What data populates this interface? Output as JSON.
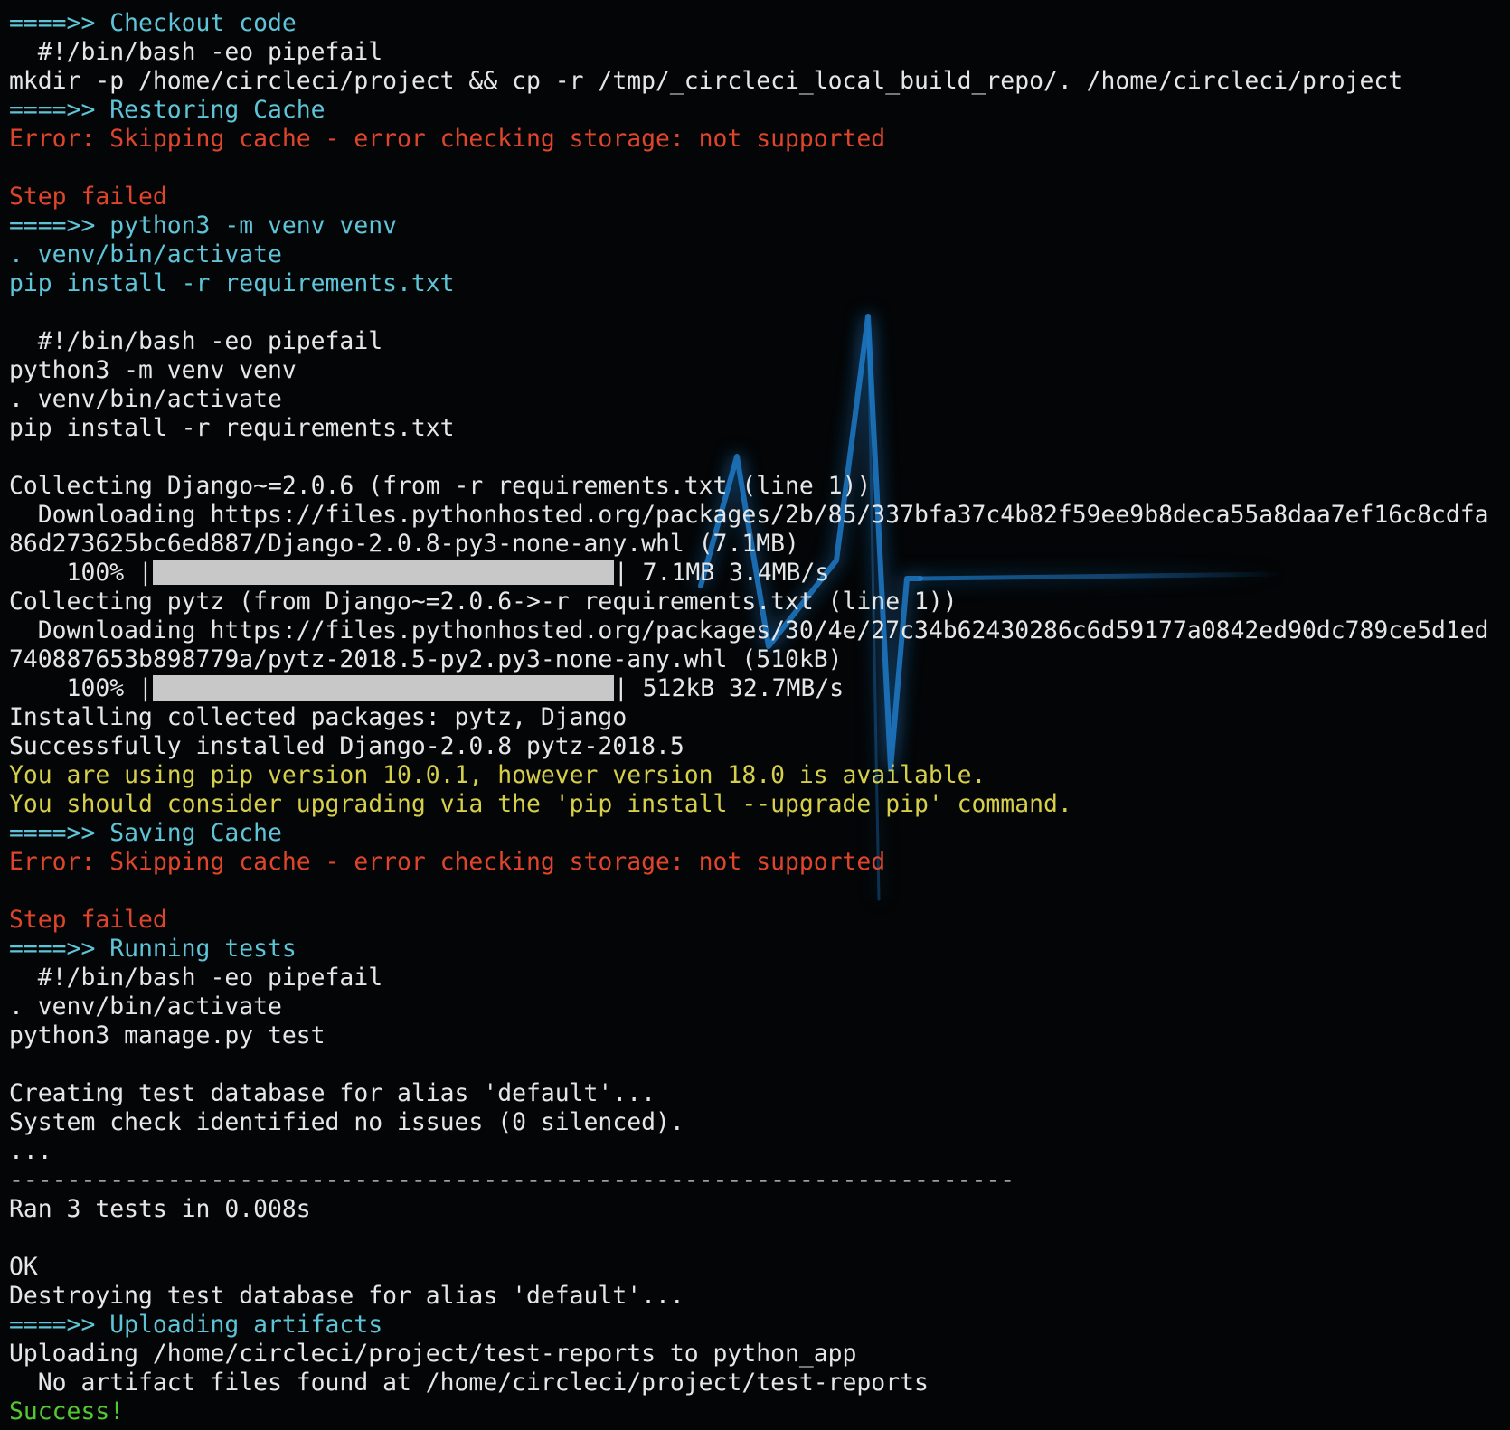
{
  "terminal": {
    "lines": [
      {
        "text": "====>> Checkout code",
        "color": "#5ec4d8"
      },
      {
        "text": "  #!/bin/bash -eo pipefail",
        "color": "#e6e6e6"
      },
      {
        "text": "mkdir -p /home/circleci/project && cp -r /tmp/_circleci_local_build_repo/. /home/circleci/project",
        "color": "#e6e6e6"
      },
      {
        "text": "====>> Restoring Cache",
        "color": "#5ec4d8"
      },
      {
        "text": "Error: Skipping cache - error checking storage: not supported",
        "color": "#e0452c"
      },
      {
        "text": "",
        "color": "#e6e6e6"
      },
      {
        "text": "Step failed",
        "color": "#e0452c"
      },
      {
        "text": "====>> python3 -m venv venv",
        "color": "#5ec4d8"
      },
      {
        "text": ". venv/bin/activate",
        "color": "#5ec4d8"
      },
      {
        "text": "pip install -r requirements.txt",
        "color": "#5ec4d8"
      },
      {
        "text": "",
        "color": "#e6e6e6"
      },
      {
        "text": "  #!/bin/bash -eo pipefail",
        "color": "#e6e6e6"
      },
      {
        "text": "python3 -m venv venv",
        "color": "#e6e6e6"
      },
      {
        "text": ". venv/bin/activate",
        "color": "#e6e6e6"
      },
      {
        "text": "pip install -r requirements.txt",
        "color": "#e6e6e6"
      },
      {
        "text": "",
        "color": "#e6e6e6"
      },
      {
        "text": "Collecting Django~=2.0.6 (from -r requirements.txt (line 1))",
        "color": "#e6e6e6"
      },
      {
        "text": "  Downloading https://files.pythonhosted.org/packages/2b/85/337bfa37c4b82f59ee9b8deca55a8daa7ef16c8cdfa",
        "color": "#e6e6e6"
      },
      {
        "text": "86d273625bc6ed887/Django-2.0.8-py3-none-any.whl (7.1MB)",
        "color": "#e6e6e6"
      },
      {
        "prefix": "    100% |",
        "progress": 1.0,
        "suffix": "| 7.1MB 3.4MB/s",
        "color": "#e6e6e6"
      },
      {
        "text": "Collecting pytz (from Django~=2.0.6->-r requirements.txt (line 1))",
        "color": "#e6e6e6"
      },
      {
        "text": "  Downloading https://files.pythonhosted.org/packages/30/4e/27c34b62430286c6d59177a0842ed90dc789ce5d1ed",
        "color": "#e6e6e6"
      },
      {
        "text": "740887653b898779a/pytz-2018.5-py2.py3-none-any.whl (510kB)",
        "color": "#e6e6e6"
      },
      {
        "prefix": "    100% |",
        "progress": 1.0,
        "suffix": "| 512kB 32.7MB/s",
        "color": "#e6e6e6"
      },
      {
        "text": "Installing collected packages: pytz, Django",
        "color": "#e6e6e6"
      },
      {
        "text": "Successfully installed Django-2.0.8 pytz-2018.5",
        "color": "#e6e6e6"
      },
      {
        "text": "You are using pip version 10.0.1, however version 18.0 is available.",
        "color": "#d5cf4a"
      },
      {
        "text": "You should consider upgrading via the 'pip install --upgrade pip' command.",
        "color": "#d5cf4a"
      },
      {
        "text": "====>> Saving Cache",
        "color": "#5ec4d8"
      },
      {
        "text": "Error: Skipping cache - error checking storage: not supported",
        "color": "#e0452c"
      },
      {
        "text": "",
        "color": "#e6e6e6"
      },
      {
        "text": "Step failed",
        "color": "#e0452c"
      },
      {
        "text": "====>> Running tests",
        "color": "#5ec4d8"
      },
      {
        "text": "  #!/bin/bash -eo pipefail",
        "color": "#e6e6e6"
      },
      {
        "text": ". venv/bin/activate",
        "color": "#e6e6e6"
      },
      {
        "text": "python3 manage.py test",
        "color": "#e6e6e6"
      },
      {
        "text": "",
        "color": "#e6e6e6"
      },
      {
        "text": "Creating test database for alias 'default'...",
        "color": "#e6e6e6"
      },
      {
        "text": "System check identified no issues (0 silenced).",
        "color": "#e6e6e6"
      },
      {
        "text": "...",
        "color": "#e6e6e6"
      },
      {
        "text": "----------------------------------------------------------------------",
        "color": "#e6e6e6"
      },
      {
        "text": "Ran 3 tests in 0.008s",
        "color": "#e6e6e6"
      },
      {
        "text": "",
        "color": "#e6e6e6"
      },
      {
        "text": "OK",
        "color": "#e6e6e6"
      },
      {
        "text": "Destroying test database for alias 'default'...",
        "color": "#e6e6e6"
      },
      {
        "text": "====>> Uploading artifacts",
        "color": "#5ec4d8"
      },
      {
        "text": "Uploading /home/circleci/project/test-reports to python_app",
        "color": "#e6e6e6"
      },
      {
        "text": "  No artifact files found at /home/circleci/project/test-reports",
        "color": "#e6e6e6"
      },
      {
        "text": "Success!",
        "color": "#54c832"
      }
    ]
  },
  "background": {
    "icon": "heartbeat-pulse-line",
    "color": "#1f7fd0"
  }
}
